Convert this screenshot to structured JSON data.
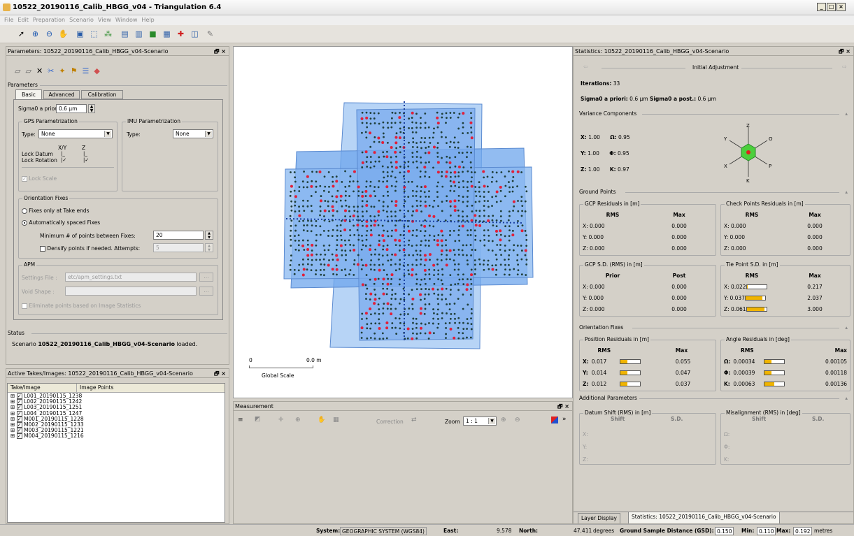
{
  "window": {
    "title": "10522_20190116_Calib_HBGG_v04 - Triangulation 6.4"
  },
  "menu": [
    "File",
    "Edit",
    "Preparation",
    "Scenario",
    "View",
    "Window",
    "Help"
  ],
  "params": {
    "title": "Parameters: 10522_20190116_Calib_HBGG_v04-Scenario",
    "section": "Parameters",
    "tabs": [
      "Basic",
      "Advanced",
      "Calibration"
    ],
    "sigma_label": "Sigma0 a priori:",
    "sigma_value": "0.6 µm",
    "gps": {
      "legend": "GPS Parametrization",
      "type_label": "Type:",
      "type_value": "None",
      "col_xy": "X/Y",
      "col_z": "Z",
      "lock_datum": "Lock Datum",
      "lock_rotation": "Lock Rotation",
      "lock_scale": "Lock Scale"
    },
    "imu": {
      "legend": "IMU Parametrization",
      "type_label": "Type:",
      "type_value": "None"
    },
    "orient": {
      "legend": "Orientation Fixes",
      "opt1": "Fixes only at Take ends",
      "opt2": "Automatically spaced Fixes",
      "min_label": "Minimum # of points between Fixes:",
      "min_value": "20",
      "densify_label": "Densify points if needed. Attempts:",
      "densify_value": "5"
    },
    "apm": {
      "legend": "APM",
      "settings_label": "Settings File :",
      "settings_value": "etc/apm_settings.txt",
      "void_label": "Void Shape :",
      "eliminate": "Eliminate points based on Image Statistics",
      "browse": "..."
    },
    "status_section": "Status",
    "status_pre": "Scenario",
    "status_name": "10522_20190116_Calib_HBGG_v04-Scenario",
    "status_post": "loaded."
  },
  "takes": {
    "title": "Active Takes/Images: 10522_20190116_Calib_HBGG_v04-Scenario",
    "col1": "Take/Image",
    "col2": "Image Points",
    "items": [
      "L001_20190115_1238",
      "L002_20190115_1242",
      "L003_20190115_1251",
      "L004_20190115_1247",
      "M001_20190115_1228",
      "M002_20190115_1233",
      "M003_20190115_1221",
      "M004_20190115_1216"
    ]
  },
  "map": {
    "scale_left": "0",
    "scale_right": "0.0 m",
    "scale_caption": "Global Scale"
  },
  "measurement": {
    "title": "Measurement",
    "correction": "Correction",
    "zoom_label": "Zoom",
    "zoom_value": "1 : 1"
  },
  "stats": {
    "title": "Statistics: 10522_20190116_Calib_HBGG_v04-Scenario",
    "nav_label": "Initial Adjustment",
    "iter_label": "Iterations:",
    "iter_value": "33",
    "sigma_prior_label": "Sigma0 a priori:",
    "sigma_prior": "0.6 µm",
    "sigma_post_label": "Sigma0 a post.:",
    "sigma_post": "0.6 µm",
    "variance": {
      "section": "Variance Components",
      "rows": [
        {
          "a": "X:",
          "av": "1.00",
          "b": "Ω:",
          "bv": "0.95"
        },
        {
          "a": "Y:",
          "av": "1.00",
          "b": "Φ:",
          "bv": "0.95"
        },
        {
          "a": "Z:",
          "av": "1.00",
          "b": "Κ:",
          "bv": "0.97"
        }
      ],
      "axes": [
        "Z",
        "O",
        "P",
        "K",
        "X",
        "Y"
      ]
    },
    "ground": {
      "section": "Ground Points",
      "gcp_res": {
        "legend": "GCP Residuals in [m]",
        "h1": "RMS",
        "h2": "Max",
        "rows": [
          [
            "X: 0.000",
            "0.000"
          ],
          [
            "Y: 0.000",
            "0.000"
          ],
          [
            "Z: 0.000",
            "0.000"
          ]
        ]
      },
      "check_res": {
        "legend": "Check Points  Residuals in [m]",
        "h1": "RMS",
        "h2": "Max",
        "rows": [
          [
            "X: 0.000",
            "0.000"
          ],
          [
            "Y: 0.000",
            "0.000"
          ],
          [
            "Z: 0.000",
            "0.000"
          ]
        ]
      },
      "gcp_sd": {
        "legend": "GCP S.D. (RMS) in [m]",
        "h1": "Prior",
        "h2": "Post",
        "rows": [
          [
            "X: 0.000",
            "0.000"
          ],
          [
            "Y: 0.000",
            "0.000"
          ],
          [
            "Z: 0.000",
            "0.000"
          ]
        ]
      },
      "tie_sd": {
        "legend": "Tie Point S.D. in [m]",
        "h1": "RMS",
        "h2": "Max",
        "rows": [
          {
            "rms": "X: 0.022",
            "max": "0.217",
            "fill": 0.05
          },
          {
            "rms": "Y: 0.037",
            "max": "2.037",
            "fill": 0.85
          },
          {
            "rms": "Z: 0.061",
            "max": "3.000",
            "fill": 0.9
          }
        ]
      }
    },
    "orient": {
      "section": "Orientation Fixes",
      "pos": {
        "legend": "Position Residuals in [m]",
        "h1": "RMS",
        "h2": "Max",
        "rows": [
          {
            "k": "X:",
            "rms": "0.017",
            "max": "0.055",
            "fill": 0.35
          },
          {
            "k": "Y:",
            "rms": "0.014",
            "max": "0.047",
            "fill": 0.35
          },
          {
            "k": "Z:",
            "rms": "0.012",
            "max": "0.037",
            "fill": 0.35
          }
        ]
      },
      "ang": {
        "legend": "Angle Residuals in [deg]",
        "h1": "RMS",
        "h2": "Max",
        "rows": [
          {
            "k": "Ω:",
            "rms": "0.00034",
            "max": "0.00105",
            "fill": 0.35
          },
          {
            "k": "Φ:",
            "rms": "0.00039",
            "max": "0.00118",
            "fill": 0.35
          },
          {
            "k": "Κ:",
            "rms": "0.00063",
            "max": "0.00136",
            "fill": 0.5
          }
        ]
      }
    },
    "additional": {
      "section": "Additional Parameters",
      "datum": {
        "legend": "Datum Shift (RMS) in [m]",
        "h1": "Shift",
        "h2": "S.D.",
        "rows": [
          "X:",
          "Y:",
          "Z:"
        ]
      },
      "misalign": {
        "legend": "Misalignment (RMS) in [deg]",
        "h1": "Shift",
        "h2": "S.D.",
        "rows": [
          "Ω:",
          "Φ:",
          "Κ:"
        ]
      }
    },
    "tabs": [
      "Layer Display",
      "Statistics: 10522_20190116_Calib_HBGG_v04-Scenario"
    ]
  },
  "statusbar": {
    "system_label": "System:",
    "system_value": "GEOGRAPHIC SYSTEM (WGS84)",
    "east_label": "East:",
    "east_value": "9.578",
    "north_label": "North:",
    "north_value": "47.411",
    "unit": "degrees",
    "gsd_label": "Ground Sample Distance (GSD):",
    "gsd_value": "0.150",
    "min_label": "Min:",
    "min_value": "0.110",
    "max_label": "Max:",
    "max_value": "0.192",
    "unit2": "metres"
  }
}
